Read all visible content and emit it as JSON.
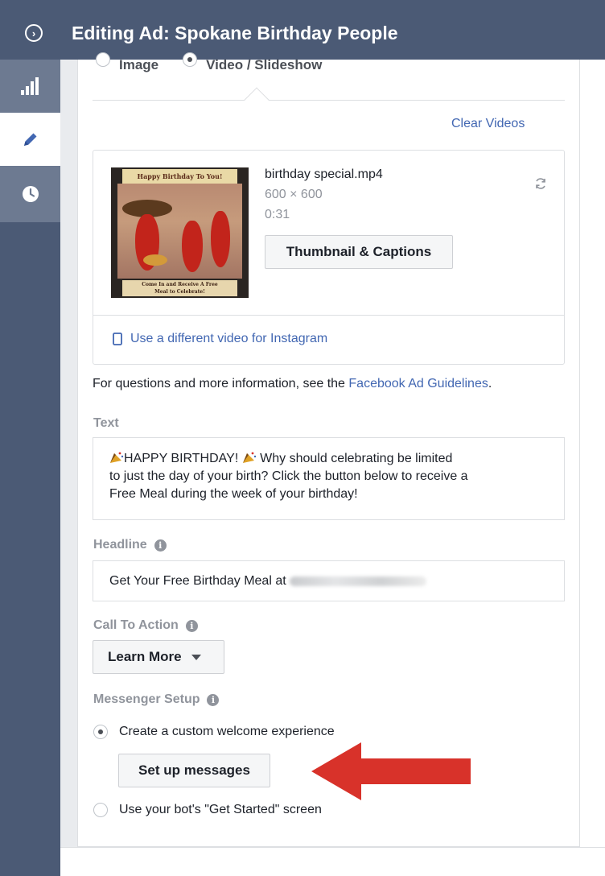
{
  "header": {
    "title": "Editing Ad: Spokane Birthday People"
  },
  "rail": {
    "items": [
      "stats-icon",
      "pencil-icon",
      "clock-icon"
    ]
  },
  "media_type": {
    "options": [
      "Image",
      "Video / Slideshow"
    ],
    "selected": "Video / Slideshow"
  },
  "clear_videos": "Clear Videos",
  "video": {
    "filename": "birthday special.mp4",
    "dimensions": "600 × 600",
    "duration": "0:31",
    "thumbnail_button": "Thumbnail & Captions",
    "thumb_banner": "Happy Birthday To You!",
    "thumb_footer_line1": "Come In and Receive A Free",
    "thumb_footer_line2": "Meal to Celebrate!",
    "instagram_link": "Use a different video for Instagram"
  },
  "guidelines": {
    "prefix": "For questions and more information, see the ",
    "link": "Facebook Ad Guidelines",
    "suffix": "."
  },
  "text_section": {
    "label": "Text",
    "line1": "HAPPY BIRTHDAY!",
    "line1_rest": " Why should celebrating be limited",
    "line2": "to just the day of your birth? Click the button below to receive a",
    "line3": "Free Meal during the week of your birthday!"
  },
  "headline": {
    "label": "Headline",
    "value": "Get Your Free Birthday Meal at"
  },
  "call_to_action": {
    "label": "Call To Action",
    "value": "Learn More"
  },
  "messenger": {
    "label": "Messenger Setup",
    "option_custom": "Create a custom welcome experience",
    "setup_button": "Set up messages",
    "option_bot": "Use your bot's \"Get Started\" screen",
    "selected": "option_custom"
  },
  "colors": {
    "header_bg": "#4b5a75",
    "link": "#4267b2",
    "arrow": "#d8322a"
  }
}
